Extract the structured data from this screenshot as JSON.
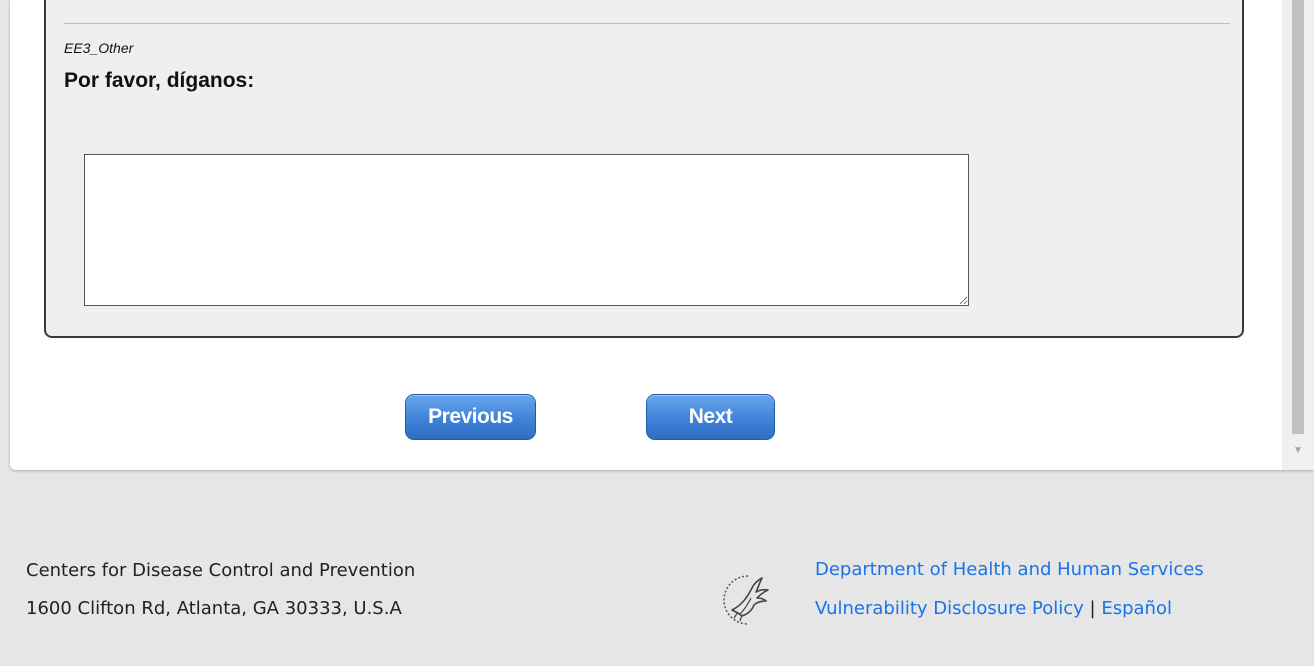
{
  "question": {
    "id": "EE3_Other",
    "text": "Por favor, díganos:",
    "answer_value": ""
  },
  "navigation": {
    "previous_label": "Previous",
    "next_label": "Next"
  },
  "footer": {
    "org_name": "Centers for Disease Control and Prevention",
    "address": "1600 Clifton Rd, Atlanta, GA 30333, U.S.A",
    "hhs_link": "Department of Health and Human Services",
    "vdp_link": "Vulnerability Disclosure Policy",
    "separator": "|",
    "spanish_link": "Español",
    "logo_icon": "hhs-eagle-icon"
  },
  "colors": {
    "button_blue": "#3f82d8",
    "link_blue": "#1a73e8",
    "footer_bg": "#e6e6e6",
    "question_bg": "#efefef"
  }
}
